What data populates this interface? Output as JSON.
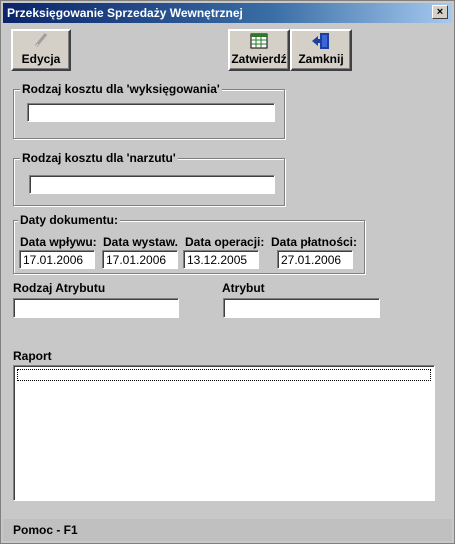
{
  "window": {
    "title": "Przeksięgowanie Sprzedaży Wewnętrznej",
    "close_label": "×"
  },
  "toolbar": {
    "edit_label": "Edycja",
    "confirm_label": "Zatwierdź",
    "close_label": "Zamknij"
  },
  "cost_out": {
    "label": "Rodzaj kosztu dla 'wyksięgowania'",
    "value": ""
  },
  "cost_markup": {
    "label": "Rodzaj kosztu dla 'narzutu'",
    "value": ""
  },
  "dates": {
    "group_label": "Daty dokumentu:",
    "fields": [
      {
        "label": "Data wpływu:",
        "value": "17.01.2006"
      },
      {
        "label": "Data wystaw.",
        "value": "17.01.2006"
      },
      {
        "label": "Data operacji:",
        "value": "13.12.2005"
      },
      {
        "label": "Data płatności:",
        "value": "27.01.2006"
      }
    ]
  },
  "attribute_type": {
    "label": "Rodzaj Atrybutu",
    "value": ""
  },
  "attribute": {
    "label": "Atrybut",
    "value": ""
  },
  "report": {
    "label": "Raport"
  },
  "statusbar": {
    "help_text": "Pomoc - F1"
  },
  "icons": {
    "edit": "pencil-icon",
    "confirm": "spreadsheet-icon",
    "close": "exit-door-icon"
  }
}
